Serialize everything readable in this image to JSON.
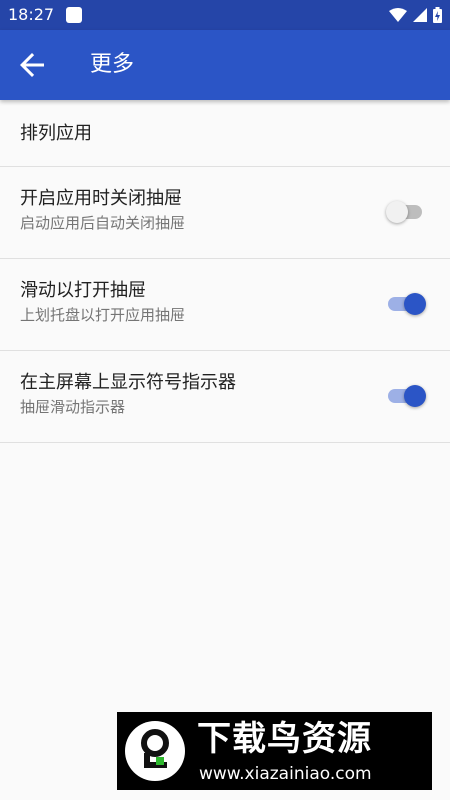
{
  "status_bar": {
    "time": "18:27"
  },
  "app_bar": {
    "title": "更多"
  },
  "list": {
    "sort_apps": {
      "title": "排列应用"
    },
    "close_drawer_on_launch": {
      "title": "开启应用时关闭抽屉",
      "subtitle": "启动应用后自动关闭抽屉",
      "enabled": false
    },
    "swipe_to_open": {
      "title": "滑动以打开抽屉",
      "subtitle": "上划托盘以打开应用抽屉",
      "enabled": true
    },
    "show_indicator": {
      "title": "在主屏幕上显示符号指示器",
      "subtitle": "抽屉滑动指示器",
      "enabled": true
    }
  },
  "watermark": {
    "title": "下载鸟资源",
    "url": "www.xiazainiao.com"
  },
  "colors": {
    "status_bar": "#2545a8",
    "app_bar": "#2b55c6",
    "accent": "#2b55c6",
    "background": "#fafafa"
  },
  "icons": [
    "notification-square-icon",
    "wifi-icon",
    "signal-icon",
    "battery-icon",
    "back-arrow-icon",
    "logo-icon"
  ]
}
